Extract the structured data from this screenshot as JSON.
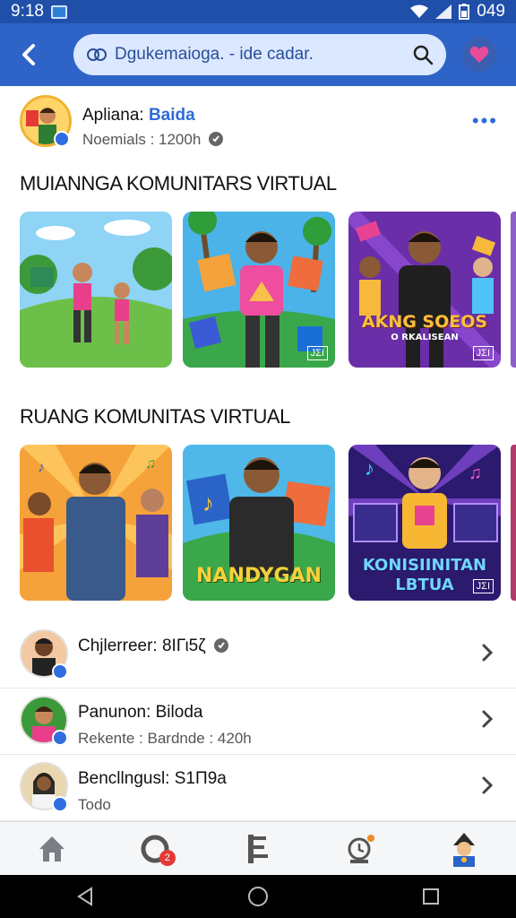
{
  "status": {
    "time": "9:18",
    "battery": "049"
  },
  "header": {
    "search_text": "Dgukemaioga. - ide cadar."
  },
  "post": {
    "name_prefix": "Apliana:",
    "name_highlight": "Baida",
    "meta": "Noemials : 1200h"
  },
  "section1": {
    "title": "MUIANNGA KOMUNITARS VIRTUAL",
    "cards": [
      {
        "caption": "",
        "tag": ""
      },
      {
        "caption": "",
        "tag": "JΣI"
      },
      {
        "caption": "AKNG SOEOS",
        "subcaption": "O RKALISEAN",
        "tag": "JΣI"
      }
    ]
  },
  "section2": {
    "title": "RUANG KOMUNITAS VIRTUAL",
    "cards": [
      {
        "caption": "",
        "tag": ""
      },
      {
        "caption": "NANDYGAN",
        "tag": ""
      },
      {
        "caption": "KONISIINITAN",
        "subcaption": "LBTUA",
        "tag": "JΣI"
      }
    ]
  },
  "list": [
    {
      "title": "Chjlerreer: 8ΙΓι5ζ",
      "subtitle": ""
    },
    {
      "title": "Panunon: Biloda",
      "subtitle": "Rekente : Bardnde : 420h"
    },
    {
      "title": "Bencllngusl: S1Π9a",
      "subtitle": "Todo"
    }
  ],
  "nav": {
    "notification_count": "2"
  },
  "colors": {
    "primary": "#2e64c8",
    "status": "#1f4fa8",
    "accent": "#2e6ad9"
  }
}
